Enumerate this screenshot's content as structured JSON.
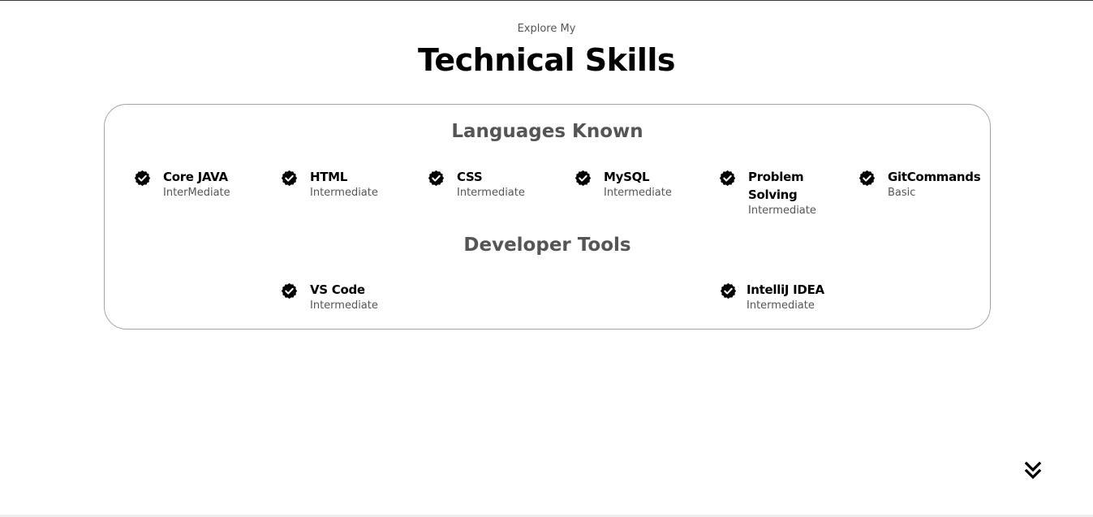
{
  "header": {
    "subtitle": "Explore My",
    "title": "Technical Skills"
  },
  "languages": {
    "title": "Languages Known",
    "items": [
      {
        "name": "Core JAVA",
        "level": "InterMediate"
      },
      {
        "name": "HTML",
        "level": "Intermediate"
      },
      {
        "name": "CSS",
        "level": "Intermediate"
      },
      {
        "name": "MySQL",
        "level": "Intermediate"
      },
      {
        "name": "Problem Solving",
        "level": "Intermediate"
      },
      {
        "name": "GitCommands",
        "level": "Basic"
      }
    ]
  },
  "tools": {
    "title": "Developer Tools",
    "items": [
      {
        "name": "VS Code",
        "level": "Intermediate"
      },
      {
        "name": "IntelliJ IDEA",
        "level": "Intermediate"
      }
    ]
  },
  "icons": {
    "skill_badge": "verified-check-icon",
    "scroll": "double-chevron-down-icon"
  },
  "colors": {
    "text": "#000000",
    "muted": "#555555",
    "card_border": "#a3a3a3"
  }
}
